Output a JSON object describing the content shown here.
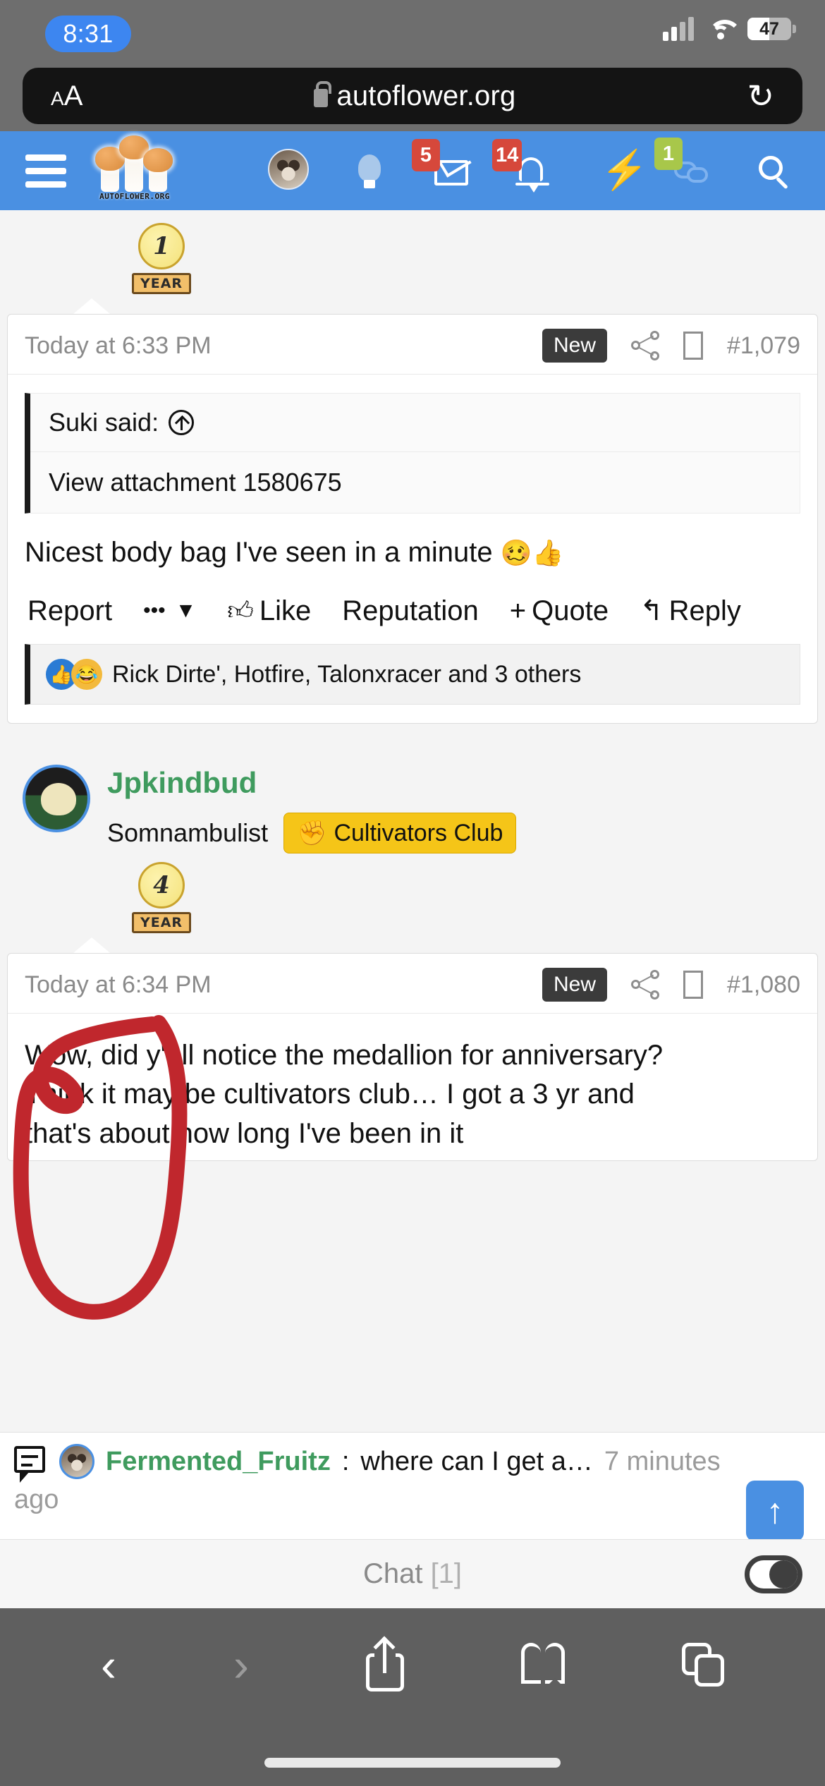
{
  "status_bar": {
    "time": "8:31",
    "battery_level": "47",
    "signal_icon": "cellular-signal-icon",
    "wifi_icon": "wifi-icon",
    "battery_icon": "battery-icon"
  },
  "browser": {
    "text_size_label_small": "A",
    "text_size_label_large": "A",
    "lock_icon": "lock-icon",
    "url": "autoflower.org",
    "reload_icon": "↻",
    "toolbar": {
      "back": "‹",
      "forward": "›",
      "share": "share-icon",
      "bookmarks": "book-icon",
      "tabs": "tabs-icon"
    }
  },
  "site_nav": {
    "menu_icon": "hamburger-menu-icon",
    "logo_text": "AUTOFLOWER.ORG",
    "items": [
      {
        "name": "user-avatar",
        "icon": "avatar-icon",
        "badge": null
      },
      {
        "name": "what-s-new",
        "icon": "lightbulb-icon",
        "badge": null
      },
      {
        "name": "inbox",
        "icon": "envelope-icon",
        "badge": "5",
        "badge_color": "#d6483b"
      },
      {
        "name": "alerts",
        "icon": "bell-icon",
        "badge": "14",
        "badge_color": "#d6483b"
      },
      {
        "name": "quick-actions",
        "icon": "lightning-bolt-icon",
        "badge": null
      },
      {
        "name": "chat",
        "icon": "speech-bubbles-icon",
        "badge": "1",
        "badge_color": "#a8c74a"
      },
      {
        "name": "search",
        "icon": "search-icon",
        "badge": null
      }
    ],
    "accent_color": "#4a90e2"
  },
  "posts": [
    {
      "medal": {
        "number": "1",
        "ribbon": "YEAR"
      },
      "date": "Today at 6:33 PM",
      "new_label": "New",
      "share_icon": "share-icon",
      "bookmark_icon": "bookmark-icon",
      "post_number": "#1,079",
      "quote": {
        "attribution": "Suki said:",
        "jump_icon": "jump-to-post-icon",
        "body": "View attachment 1580675"
      },
      "body": "Nicest body bag I've seen in a minute",
      "body_emoji": "🥴👍",
      "actions": {
        "report": "Report",
        "more_dots": "•••",
        "more_caret": "▼",
        "like_icon": "thumbs-up-icon",
        "like": "Like",
        "reputation": "Reputation",
        "quote_plus": "+",
        "quote": "Quote",
        "reply_icon": "reply-arrow-icon",
        "reply": "Reply"
      },
      "reactions": {
        "icons": [
          "thumbs-up-reaction",
          "haha-reaction"
        ],
        "names": "Rick Dirte', Hotfire, Talonxracer and 3 others"
      }
    },
    {
      "author": {
        "username": "Jpkindbud",
        "username_color": "#3f9b5e",
        "title": "Somnambulist",
        "club_badge": "Cultivators Club",
        "club_badge_icon": "raised-fist-icon",
        "club_badge_color": "#f5c518",
        "avatar_icon": "user-avatar"
      },
      "medal": {
        "number": "4",
        "ribbon": "YEAR"
      },
      "date": "Today at 6:34 PM",
      "new_label": "New",
      "share_icon": "share-icon",
      "bookmark_icon": "bookmark-icon",
      "post_number": "#1,080",
      "body_lines": [
        "Wow, did y'all notice the medallion for anniversary?",
        "Think it may be cultivators club… I got a 3 yr and",
        "that's about how long I've been in it"
      ]
    }
  ],
  "chat_notification": {
    "message_icon": "chat-message-icon",
    "avatar_icon": "user-avatar",
    "username": "Fermented_Fruitz",
    "separator": ": ",
    "message": "where can I get a…",
    "time_part1": "7 minutes",
    "time_part2": "ago",
    "scroll_top_icon": "↑"
  },
  "chat_footer": {
    "label": "Chat",
    "count": "[1]",
    "toggle_icon": "toggle-switch-icon",
    "toggle_state": "on"
  },
  "annotation": {
    "type": "hand-drawn-red-circle",
    "color": "#c0272d"
  }
}
